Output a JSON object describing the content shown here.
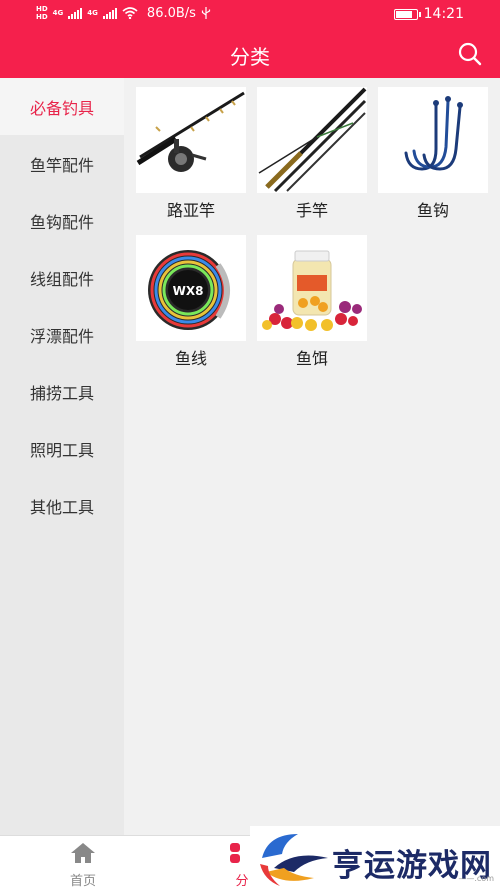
{
  "status_bar": {
    "hd1": "HD",
    "hd2": "HD",
    "net1": "4G",
    "net2": "4G",
    "speed": "86.0B/s",
    "time": "14:21"
  },
  "header": {
    "title": "分类",
    "search_icon": "search-icon"
  },
  "sidebar": {
    "items": [
      {
        "label": "必备钓具",
        "active": true
      },
      {
        "label": "鱼竿配件"
      },
      {
        "label": "鱼钩配件"
      },
      {
        "label": "线组配件"
      },
      {
        "label": "浮漂配件"
      },
      {
        "label": "捕捞工具"
      },
      {
        "label": "照明工具"
      },
      {
        "label": "其他工具"
      }
    ]
  },
  "products": [
    {
      "label": "路亚竿",
      "image": "spinning-rod-with-reel"
    },
    {
      "label": "手竿",
      "image": "telescopic-hand-rod"
    },
    {
      "label": "鱼钩",
      "image": "fish-hooks"
    },
    {
      "label": "鱼线",
      "image": "fishing-line-spool"
    },
    {
      "label": "鱼饵",
      "image": "bait-bottle"
    }
  ],
  "bottom_nav": {
    "tabs": [
      {
        "label": "首页",
        "icon": "home-icon"
      },
      {
        "label": "分",
        "icon": "category-icon",
        "active": true
      }
    ]
  },
  "watermark": {
    "text": "亨运游戏网",
    "url": "——.com"
  },
  "colors": {
    "accent": "#f5204c",
    "active_text": "#e8244a"
  }
}
